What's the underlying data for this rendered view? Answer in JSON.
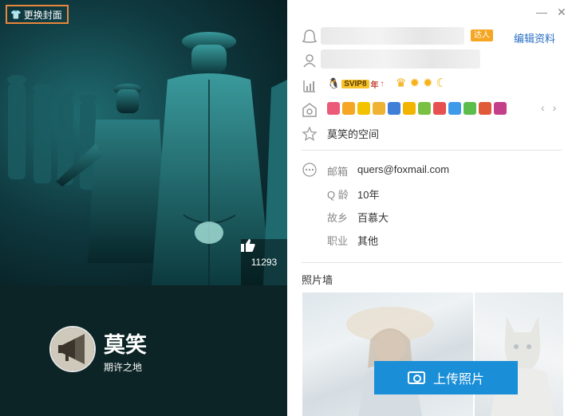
{
  "cover": {
    "change_cover_label": "更换封面",
    "like_count": "11293",
    "nickname": "莫笑",
    "signature": "期许之地"
  },
  "window": {
    "minimize_glyph": "—",
    "close_glyph": "✕"
  },
  "profile": {
    "badge_label": "达人",
    "edit_label": "编辑资料",
    "svip_label": "SVIP8",
    "svip_year": "年",
    "space_label": "莫笑的空间"
  },
  "info": {
    "email_label": "邮箱",
    "email_value": "quers@foxmail.com",
    "qage_label": "Q 龄",
    "qage_value": "10年",
    "hometown_label": "故乡",
    "hometown_value": "百慕大",
    "job_label": "职业",
    "job_value": "其他"
  },
  "photos": {
    "title": "照片墙",
    "upload_label": "上传照片"
  },
  "colors": {
    "accent_blue": "#1a8fd8",
    "link_blue": "#2a6fc4",
    "highlight_orange": "#e9873a"
  }
}
